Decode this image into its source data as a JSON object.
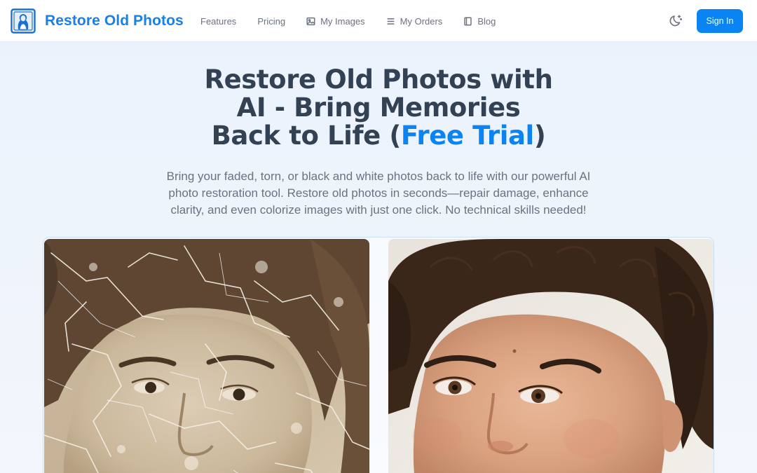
{
  "navbar": {
    "brand": "Restore Old Photos",
    "logo_icon": "portrait-frame-icon",
    "links": [
      {
        "label": "Features",
        "icon": ""
      },
      {
        "label": "Pricing",
        "icon": ""
      },
      {
        "label": "My Images",
        "icon": "image-icon"
      },
      {
        "label": "My Orders",
        "icon": "list-icon"
      },
      {
        "label": "Blog",
        "icon": "book-icon"
      }
    ],
    "theme_toggle_icon": "moon-sparkle-icon",
    "sign_in_label": "Sign In"
  },
  "hero": {
    "title_line1": "Restore Old Photos with",
    "title_line2": "AI - Bring Memories",
    "title_line3_prefix": "Back to Life (",
    "title_highlight": "Free Trial",
    "title_line3_suffix": ")",
    "subtitle_line1": "Bring your faded, torn, or black and white photos back to life with our powerful AI",
    "subtitle_line2": "photo restoration tool. Restore old photos in seconds—repair damage, enhance",
    "subtitle_line3": "clarity, and even colorize images with just one click. No technical skills needed!"
  },
  "comparison": {
    "before_image": "damaged-sepia-portrait",
    "after_image": "restored-color-portrait"
  },
  "colors": {
    "accent": "#0b84f3",
    "brand": "#1a7fe6",
    "heading": "#334155",
    "muted": "#6b7280"
  }
}
